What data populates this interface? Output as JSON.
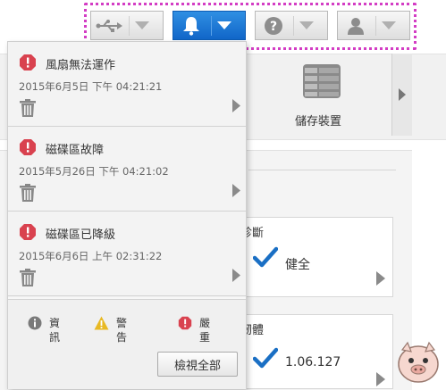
{
  "toolbar": {
    "buttons": [
      {
        "name": "usb",
        "icon": "usb-icon",
        "active": false
      },
      {
        "name": "notifications",
        "icon": "bell-icon",
        "active": true
      },
      {
        "name": "help",
        "icon": "help-icon",
        "active": false
      },
      {
        "name": "user",
        "icon": "user-icon",
        "active": false
      }
    ],
    "active_color": "#1a74d4",
    "highlight_color": "#d33dc4"
  },
  "dashboard": {
    "storage_label": "儲存裝置",
    "diagnosis_title": "診斷",
    "diagnosis_value": "健全",
    "firmware_title": "韌體",
    "firmware_value": "1.06.127"
  },
  "notifications": {
    "items": [
      {
        "title": "風扇無法運作",
        "time": "2015年6月5日 下午 04:21:21",
        "severity": "error"
      },
      {
        "title": "磁碟區故障",
        "time": "2015年5月26日 下午 04:21:02",
        "severity": "error"
      },
      {
        "title": "磁碟區已降級",
        "time": "2015年6月6日 上午 02:31:22",
        "severity": "error"
      }
    ],
    "legend": {
      "info": "資訊",
      "warning": "警告",
      "critical": "嚴重"
    },
    "view_all_label": "檢視全部",
    "colors": {
      "error": "#d9424f",
      "warning": "#e8b923",
      "info": "#7a7a7a"
    }
  }
}
